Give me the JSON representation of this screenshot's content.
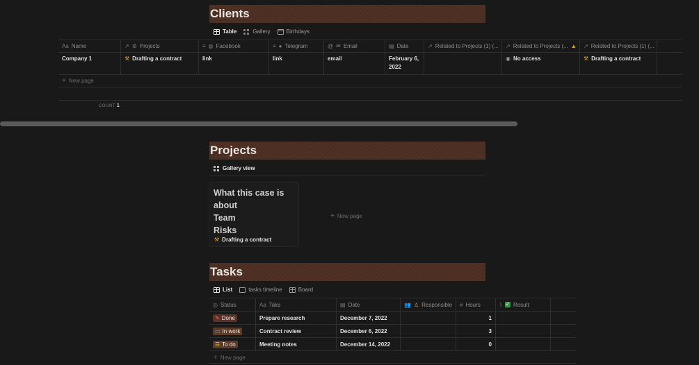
{
  "clients": {
    "title": "Clients",
    "views": [
      "Table",
      "Gallery",
      "Birthdays"
    ],
    "columns": [
      "Name",
      "Projects",
      "Facebook",
      "Telegram",
      "Email",
      "Date",
      "Related to Projects (1) (...",
      "Related to Projects (...",
      "Related to Projects (1) (..."
    ],
    "row": {
      "name": "Company 1",
      "project": "Drafting a contract",
      "facebook": "link",
      "telegram": "link",
      "email": "email",
      "date": "February 6, 2022",
      "related2": "No access",
      "related3": "Drafting a contract"
    },
    "new_page": "New page",
    "count_label": "COUNT",
    "count_value": "1"
  },
  "projects": {
    "title": "Projects",
    "view": "Gallery view",
    "card_preview": [
      "What this case  is about",
      "Team",
      "Risks"
    ],
    "card_title": "Drafting a contract",
    "new_page": "New page"
  },
  "tasks": {
    "title": "Tasks",
    "views": [
      "List",
      "tasks timeline",
      "Board"
    ],
    "columns": [
      "Status",
      "Taks",
      "Date",
      "Responsible",
      "Hours",
      "Result"
    ],
    "rows": [
      {
        "status": "Done",
        "status_color": "#5a3128",
        "task": "Prepare research",
        "date": "December 7, 2022",
        "hours": "1"
      },
      {
        "status": "In work",
        "status_color": "#5a3c26",
        "task": "Contract review",
        "date": "December 6, 2022",
        "hours": "3"
      },
      {
        "status": "To do",
        "status_color": "#5a3a2a",
        "task": "Meeting notes",
        "date": "December 14, 2022",
        "hours": "0"
      }
    ],
    "new_page": "New page"
  },
  "colors": {
    "background": "#191919",
    "title_bg": "#4a2c20",
    "border": "#2f2f2f"
  }
}
